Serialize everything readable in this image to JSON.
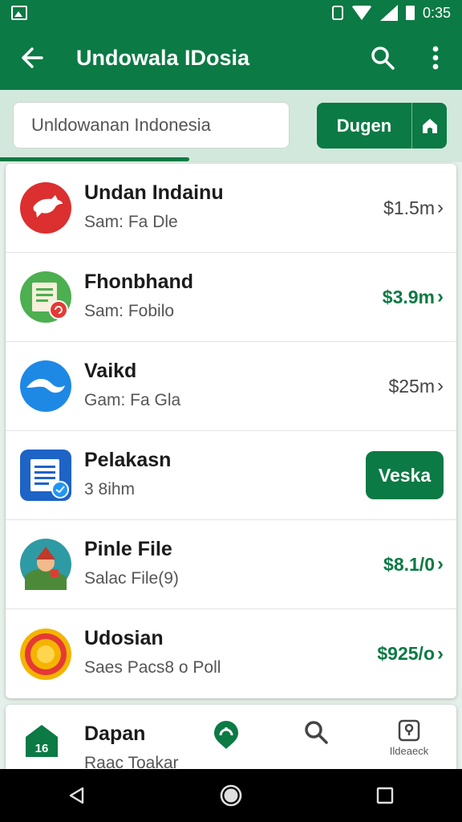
{
  "status_bar": {
    "time": "0:35"
  },
  "app_bar": {
    "title": "Undowala IDosia"
  },
  "search": {
    "value": "Unldowanan Indonesia",
    "button_label": "Dugen"
  },
  "list": [
    {
      "title": "Undan Indainu",
      "subtitle": "Sam: Fa Dle",
      "price": "$1.5m",
      "price_accent": false,
      "icon": "bird-icon",
      "color": "#dc2f2f"
    },
    {
      "title": "Fhonbhand",
      "subtitle": "Sam: Fobilo",
      "price": "$3.9m",
      "price_accent": true,
      "icon": "document-icon",
      "color": "#4caf50"
    },
    {
      "title": "Vaikd",
      "subtitle": "Gam: Fa Gla",
      "price": "$25m",
      "price_accent": false,
      "icon": "map-icon",
      "color": "#1e88e5"
    },
    {
      "title": "Pelakasn",
      "subtitle": "3 8ihm",
      "button_label": "Veska",
      "icon": "doc-blue-icon",
      "color": "#1e63c6"
    },
    {
      "title": "Pinle File",
      "subtitle": "Salac File(9)",
      "price": "$8.1/0",
      "price_accent": true,
      "icon": "person-icon",
      "color": "#2e9aa3"
    },
    {
      "title": "Udosian",
      "subtitle": "Saes Pacs8 o Poll",
      "price": "$925/o",
      "price_accent": true,
      "icon": "sun-icon",
      "color": "#f4b400"
    }
  ],
  "bottom": {
    "badge": "16",
    "title": "Dapan",
    "subtitle": "Raac Toakar",
    "nav_label": "Ildeaeck"
  },
  "colors": {
    "primary": "#0b7a44",
    "surface": "#ffffff"
  }
}
